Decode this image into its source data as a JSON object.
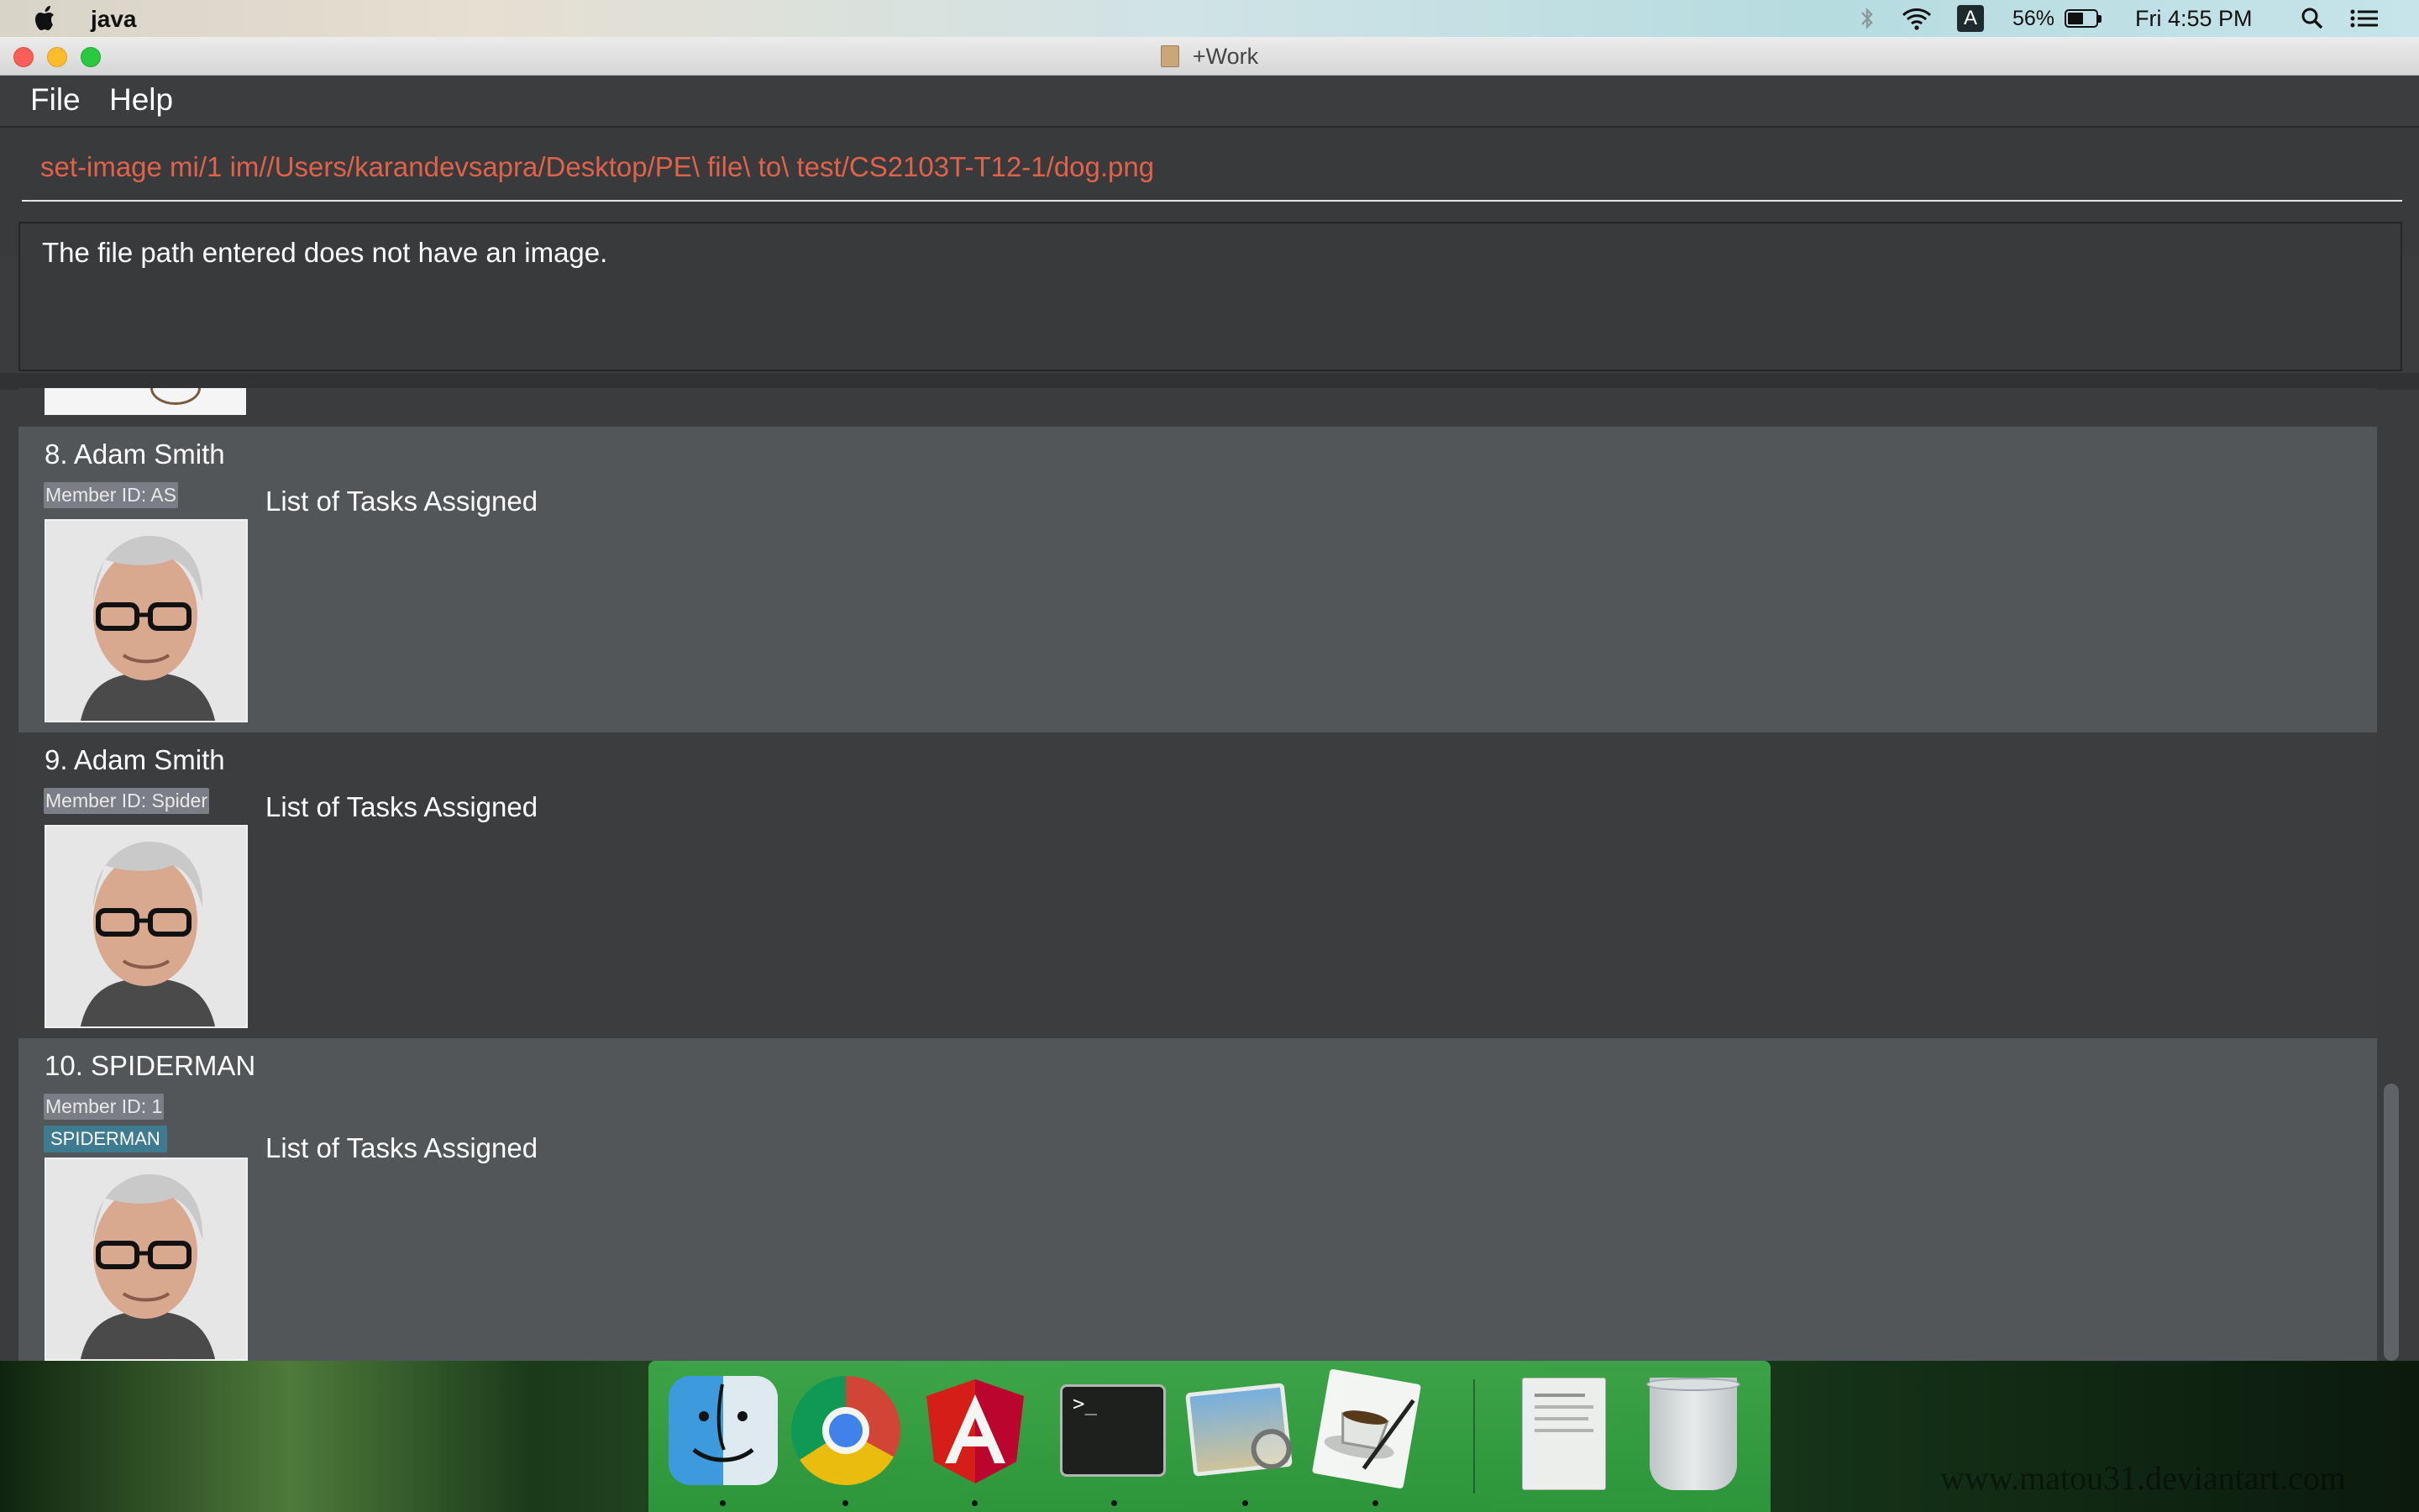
{
  "menubar": {
    "app_name": "java",
    "battery_percent": "56%",
    "clock": "Fri 4:55 PM",
    "input_source": "A"
  },
  "window": {
    "title": "+Work"
  },
  "app_menu": {
    "file_label": "File",
    "help_label": "Help"
  },
  "command": {
    "value": "set-image mi/1 im//Users/karandevsapra/Desktop/PE\\ file\\ to\\ test/CS2103T-T12-1/dog.png"
  },
  "result": {
    "message": "The file path entered does not have an image."
  },
  "members": [
    {
      "index_name": "8.  Adam Smith",
      "member_id": "Member ID: AS",
      "tags": [],
      "tasks_label": "List of Tasks Assigned"
    },
    {
      "index_name": "9.  Adam Smith",
      "member_id": "Member ID: Spider",
      "tags": [],
      "tasks_label": "List of Tasks Assigned"
    },
    {
      "index_name": "10.  SPIDERMAN",
      "member_id": "Member ID: 1",
      "tags": [
        "SPIDERMAN"
      ],
      "tasks_label": "List of Tasks Assigned"
    }
  ],
  "dock": {
    "apps": [
      "finder-icon",
      "chrome-icon",
      "angular-icon",
      "terminal-icon",
      "preview-icon",
      "java-coffee-icon",
      "documents-icon",
      "trash-icon"
    ]
  },
  "watermark": "www.matou31.deviantart.com",
  "colors": {
    "command_text": "#e0624a",
    "card_light": "#525659",
    "card_dark": "#3b3d3f",
    "tag_bg": "#3e7b91"
  }
}
